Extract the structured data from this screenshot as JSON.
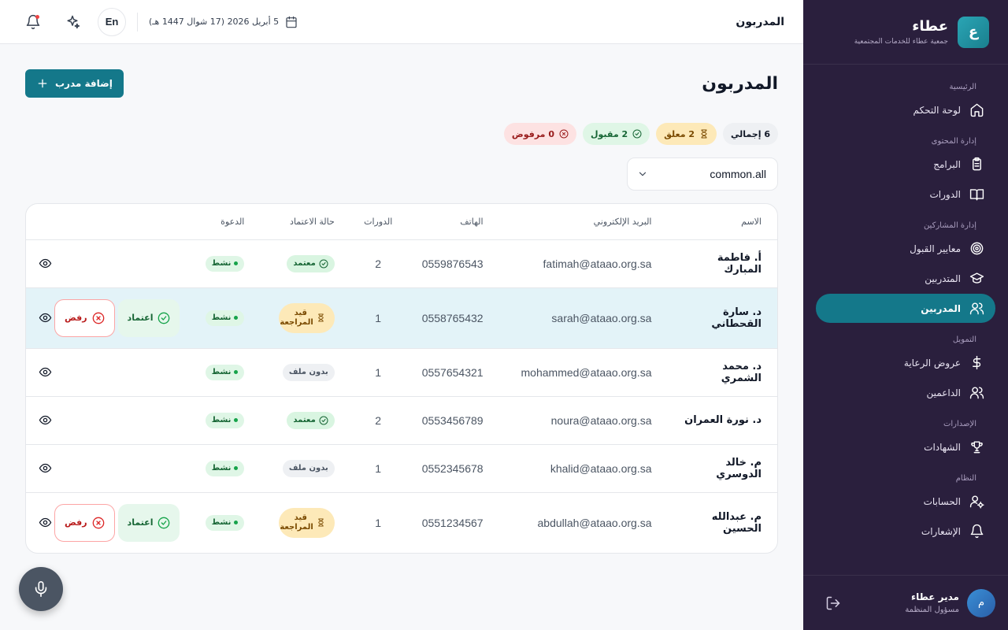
{
  "brand": {
    "logo_letter": "ع",
    "name": "عطاء",
    "subtitle": "جمعية عطاء للخدمات المجتمعية"
  },
  "nav": [
    {
      "title": "الرئيسية",
      "items": [
        {
          "label": "لوحة التحكم",
          "icon": "home-icon"
        }
      ]
    },
    {
      "title": "إدارة المحتوى",
      "items": [
        {
          "label": "البرامج",
          "icon": "clipboard-icon"
        },
        {
          "label": "الدورات",
          "icon": "book-icon"
        }
      ]
    },
    {
      "title": "إدارة المشاركين",
      "items": [
        {
          "label": "معايير القبول",
          "icon": "target-icon"
        },
        {
          "label": "المتدربين",
          "icon": "graduation-cap-icon"
        },
        {
          "label": "المدربين",
          "icon": "users-icon",
          "active": true
        }
      ]
    },
    {
      "title": "التمويل",
      "items": [
        {
          "label": "عروض الرعاية",
          "icon": "dollar-icon"
        },
        {
          "label": "الداعمين",
          "icon": "users-icon"
        }
      ]
    },
    {
      "title": "الإصدارات",
      "items": [
        {
          "label": "الشهادات",
          "icon": "trophy-icon"
        }
      ]
    },
    {
      "title": "النظام",
      "items": [
        {
          "label": "الحسابات",
          "icon": "user-gear-icon"
        },
        {
          "label": "الإشعارات",
          "icon": "bell-icon"
        }
      ]
    }
  ],
  "user": {
    "initial": "م",
    "name": "مدير عطاء",
    "role": "مسؤول المنظمة"
  },
  "topbar": {
    "title": "المدربون",
    "lang": "En",
    "date": "5 أبريل 2026 (17 شوال 1447 هـ)"
  },
  "page": {
    "title": "المدربون",
    "add_button": "إضافة مدرب",
    "stats": {
      "total": "6 إجمالي",
      "pending": "2 معلق",
      "accepted": "2 مقبول",
      "rejected": "0 مرفوض"
    },
    "filter_value": "common.all"
  },
  "table": {
    "headers": {
      "name": "الاسم",
      "email": "البريد الإلكتروني",
      "phone": "الهاتف",
      "courses": "الدورات",
      "status": "حالة الاعتماد",
      "invite": "الدعوة"
    },
    "labels": {
      "approved": "معتمد",
      "review_1": "قيد",
      "review_2": "المراجعة",
      "noprofile": "بدون ملف",
      "active": "نشط",
      "approve": "اعتماد",
      "reject": "رفض"
    },
    "rows": [
      {
        "name": "أ. فاطمة المبارك",
        "email": "fatimah@ataao.org.sa",
        "phone": "0559876543",
        "courses": "2",
        "status": "approved"
      },
      {
        "name": "د. سارة القحطاني",
        "email": "sarah@ataao.org.sa",
        "phone": "0558765432",
        "courses": "1",
        "status": "review"
      },
      {
        "name": "د. محمد الشمري",
        "email": "mohammed@ataao.org.sa",
        "phone": "0557654321",
        "courses": "1",
        "status": "noprofile"
      },
      {
        "name": "د. نورة العمران",
        "email": "noura@ataao.org.sa",
        "phone": "0553456789",
        "courses": "2",
        "status": "approved"
      },
      {
        "name": "م. خالد الدوسري",
        "email": "khalid@ataao.org.sa",
        "phone": "0552345678",
        "courses": "1",
        "status": "noprofile"
      },
      {
        "name": "م. عبدالله الحسين",
        "email": "abdullah@ataao.org.sa",
        "phone": "0551234567",
        "courses": "1",
        "status": "review"
      }
    ]
  },
  "colors": {
    "sidebar": "#2a1f3d",
    "accent": "#14788a"
  }
}
